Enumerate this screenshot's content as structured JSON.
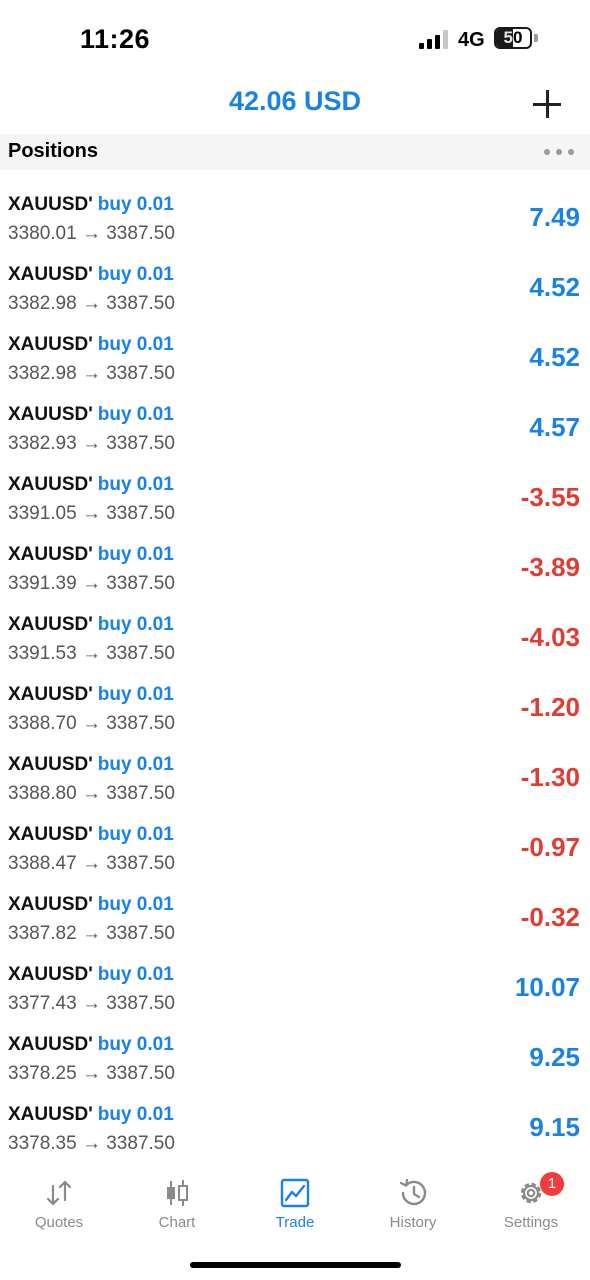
{
  "status_bar": {
    "time": "11:26",
    "network": "4G",
    "battery": "50"
  },
  "header": {
    "balance": "42.06 USD",
    "add_icon": "plus-icon"
  },
  "section": {
    "title": "Positions",
    "more_icon": "ellipsis-icon"
  },
  "colors": {
    "accent": "#1a82e6",
    "positive": "#1a82e6",
    "negative": "#e03c31"
  },
  "positions": [
    {
      "symbol": "XAUUSD'",
      "side": "buy 0.01",
      "prices": "3380.01 → 3387.50",
      "profit": "7.49",
      "sign": "positive"
    },
    {
      "symbol": "XAUUSD'",
      "side": "buy 0.01",
      "prices": "3382.98 → 3387.50",
      "profit": "4.52",
      "sign": "positive"
    },
    {
      "symbol": "XAUUSD'",
      "side": "buy 0.01",
      "prices": "3382.98 → 3387.50",
      "profit": "4.52",
      "sign": "positive"
    },
    {
      "symbol": "XAUUSD'",
      "side": "buy 0.01",
      "prices": "3382.93 → 3387.50",
      "profit": "4.57",
      "sign": "positive"
    },
    {
      "symbol": "XAUUSD'",
      "side": "buy 0.01",
      "prices": "3391.05 → 3387.50",
      "profit": "-3.55",
      "sign": "negative"
    },
    {
      "symbol": "XAUUSD'",
      "side": "buy 0.01",
      "prices": "3391.39 → 3387.50",
      "profit": "-3.89",
      "sign": "negative"
    },
    {
      "symbol": "XAUUSD'",
      "side": "buy 0.01",
      "prices": "3391.53 → 3387.50",
      "profit": "-4.03",
      "sign": "negative"
    },
    {
      "symbol": "XAUUSD'",
      "side": "buy 0.01",
      "prices": "3388.70 → 3387.50",
      "profit": "-1.20",
      "sign": "negative"
    },
    {
      "symbol": "XAUUSD'",
      "side": "buy 0.01",
      "prices": "3388.80 → 3387.50",
      "profit": "-1.30",
      "sign": "negative"
    },
    {
      "symbol": "XAUUSD'",
      "side": "buy 0.01",
      "prices": "3388.47 → 3387.50",
      "profit": "-0.97",
      "sign": "negative"
    },
    {
      "symbol": "XAUUSD'",
      "side": "buy 0.01",
      "prices": "3387.82 → 3387.50",
      "profit": "-0.32",
      "sign": "negative"
    },
    {
      "symbol": "XAUUSD'",
      "side": "buy 0.01",
      "prices": "3377.43 → 3387.50",
      "profit": "10.07",
      "sign": "positive"
    },
    {
      "symbol": "XAUUSD'",
      "side": "buy 0.01",
      "prices": "3378.25 → 3387.50",
      "profit": "9.25",
      "sign": "positive"
    },
    {
      "symbol": "XAUUSD'",
      "side": "buy 0.01",
      "prices": "3378.35 → 3387.50",
      "profit": "9.15",
      "sign": "positive"
    }
  ],
  "tabs": [
    {
      "label": "Quotes",
      "icon": "quotes-arrows-icon"
    },
    {
      "label": "Chart",
      "icon": "candlestick-icon"
    },
    {
      "label": "Trade",
      "icon": "trade-chart-icon",
      "active": true
    },
    {
      "label": "History",
      "icon": "history-clock-icon"
    },
    {
      "label": "Settings",
      "icon": "gear-icon",
      "badge": "1"
    }
  ]
}
